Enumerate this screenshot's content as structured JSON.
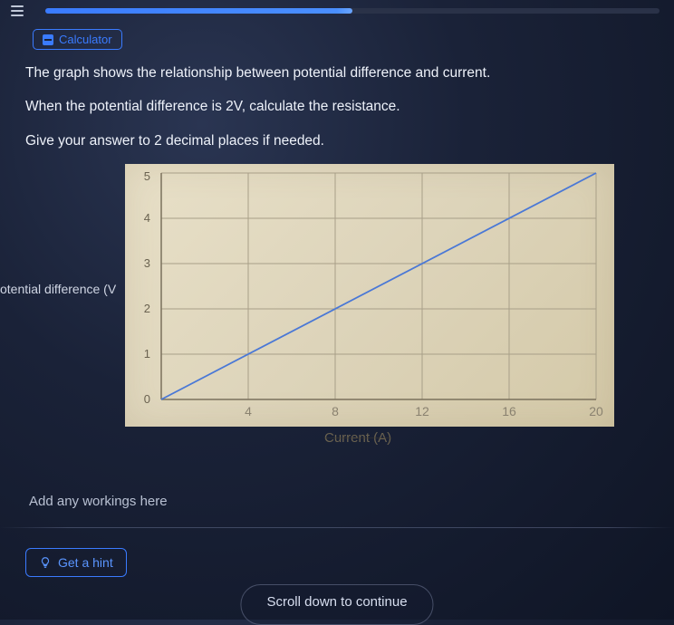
{
  "header": {
    "calculator_label": "Calculator",
    "progress_pct": 50
  },
  "question": {
    "line1": "The graph shows the relationship between potential difference and current.",
    "line2": "When the potential difference is 2V, calculate the resistance.",
    "line3": "Give your answer to 2 decimal places if needed."
  },
  "chart_data": {
    "type": "line",
    "title": "",
    "xlabel": "Current (A)",
    "ylabel": "otential difference (V",
    "xlim": [
      0,
      20
    ],
    "ylim": [
      0,
      5
    ],
    "xticks": [
      0,
      4,
      8,
      12,
      16,
      20
    ],
    "yticks": [
      0,
      1,
      2,
      3,
      4,
      5
    ],
    "series": [
      {
        "name": "line",
        "points": [
          [
            0,
            0
          ],
          [
            20,
            5
          ]
        ],
        "color": "#4a78d6"
      }
    ]
  },
  "workings": {
    "placeholder": "Add any workings here"
  },
  "footer": {
    "hint_label": "Get a hint",
    "scroll_label": "Scroll down to continue"
  }
}
